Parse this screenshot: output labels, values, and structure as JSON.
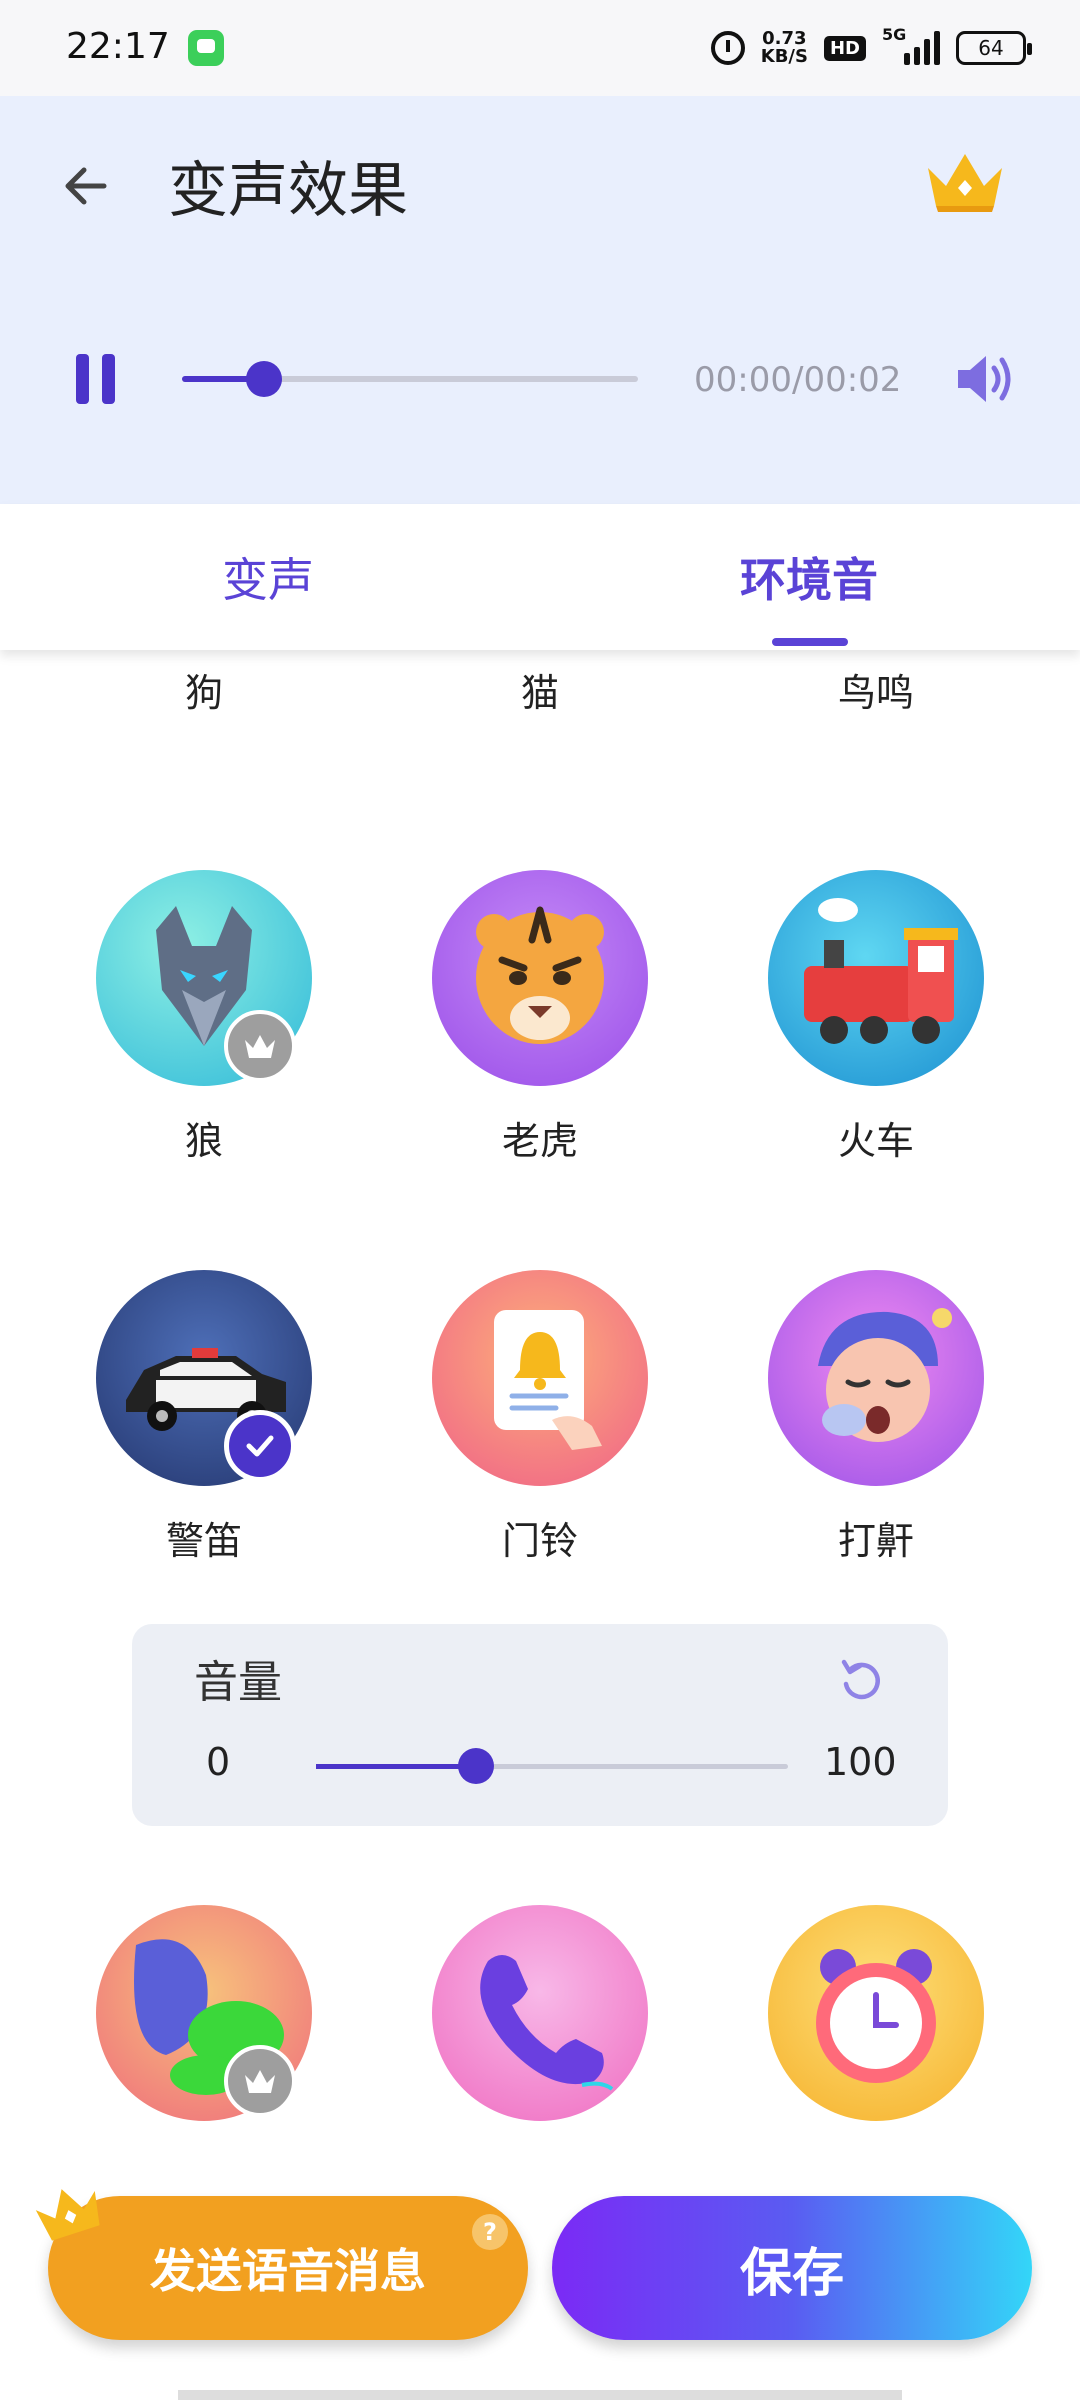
{
  "status_bar": {
    "time": "22:17",
    "net_speed_value": "0.73",
    "net_speed_unit": "KB/S",
    "hd": "HD",
    "network": "5G",
    "battery": "64"
  },
  "header": {
    "title": "变声效果",
    "playback": {
      "time": "00:00/00:02",
      "progress": 0.18
    }
  },
  "tabs": [
    {
      "label": "变声",
      "active": false
    },
    {
      "label": "环境音",
      "active": true
    }
  ],
  "effects": [
    {
      "label": "狗",
      "vip": true,
      "selected": false,
      "icon": "dog-icon"
    },
    {
      "label": "猫",
      "vip": true,
      "selected": false,
      "icon": "cat-icon"
    },
    {
      "label": "鸟鸣",
      "vip": false,
      "selected": false,
      "icon": "bird-icon"
    },
    {
      "label": "狼",
      "vip": true,
      "selected": false,
      "icon": "wolf-icon"
    },
    {
      "label": "老虎",
      "vip": false,
      "selected": false,
      "icon": "tiger-icon"
    },
    {
      "label": "火车",
      "vip": false,
      "selected": false,
      "icon": "train-icon"
    },
    {
      "label": "警笛",
      "vip": false,
      "selected": true,
      "icon": "police-car-icon"
    },
    {
      "label": "门铃",
      "vip": false,
      "selected": false,
      "icon": "doorbell-icon"
    },
    {
      "label": "打鼾",
      "vip": false,
      "selected": false,
      "icon": "snore-icon"
    },
    {
      "vip": true,
      "selected": false,
      "icon": "fart-icon"
    },
    {
      "vip": false,
      "selected": false,
      "icon": "phone-icon"
    },
    {
      "vip": false,
      "selected": false,
      "icon": "alarm-clock-icon"
    }
  ],
  "volume": {
    "title": "音量",
    "min": "0",
    "max": "100",
    "value": 34
  },
  "buttons": {
    "send": "发送语音消息",
    "help": "?",
    "save": "保存"
  },
  "colors": {
    "accent": "#5a43d6",
    "header_bg": "#e9effd",
    "send_orange": "#f2a020"
  }
}
